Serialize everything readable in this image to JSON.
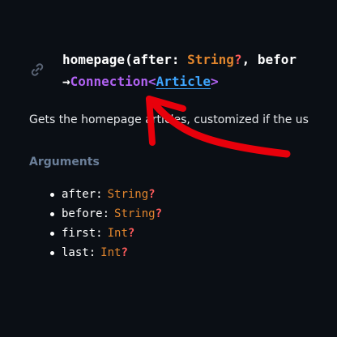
{
  "signature": {
    "link_icon": "link-icon",
    "name": "homepage",
    "open_paren": "(",
    "param1_name": "after",
    "param1_colon": ": ",
    "param1_type": "String",
    "param1_q": "?",
    "comma": ", ",
    "param2_trunc": "befor",
    "arrow": "→",
    "return_type": "Connection",
    "lt": "<",
    "inner_type": "Article",
    "gt": ">"
  },
  "description": "Gets the homepage articles, customized if the us",
  "arguments": {
    "heading": "Arguments",
    "items": [
      {
        "name": "after",
        "colon": ":",
        "type": "String",
        "q": "?"
      },
      {
        "name": "before",
        "colon": ":",
        "type": "String",
        "q": "?"
      },
      {
        "name": "first",
        "colon": ":",
        "type": "Int",
        "q": "?"
      },
      {
        "name": "last",
        "colon": ":",
        "type": "Int",
        "q": "?"
      }
    ]
  },
  "colors": {
    "background": "#0b0f15",
    "type_orange": "#e1852d",
    "nullable_red": "#ff5c5c",
    "purple": "#b162f2",
    "link_blue": "#3ea6ff",
    "heading_gray": "#6b7f99",
    "annotation_red": "#e8000b"
  }
}
